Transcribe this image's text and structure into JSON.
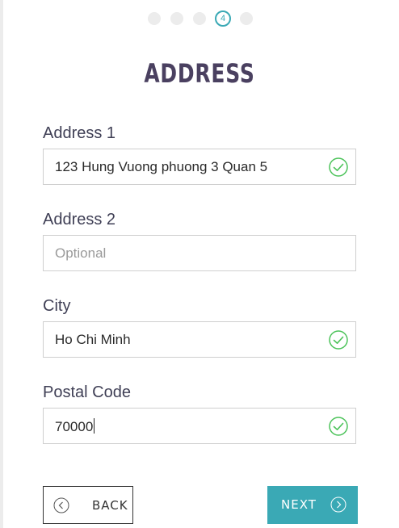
{
  "stepper": {
    "current_step": "4",
    "total_steps": 5
  },
  "page": {
    "title": "ADDRESS"
  },
  "form": {
    "address1": {
      "label": "Address 1",
      "value": "123 Hung Vuong phuong 3 Quan 5"
    },
    "address2": {
      "label": "Address 2",
      "placeholder": "Optional"
    },
    "city": {
      "label": "City",
      "value": "Ho Chi Minh"
    },
    "postal": {
      "label": "Postal Code",
      "value": "70000"
    }
  },
  "buttons": {
    "back_label": "BACK",
    "next_label": "NEXT"
  },
  "colors": {
    "accent": "#3aa9b5",
    "title": "#4a4060",
    "valid": "#4cc35a"
  },
  "icons": {
    "valid": "check-circle-icon",
    "back": "chevron-left-circle-icon",
    "next": "chevron-right-circle-icon"
  }
}
